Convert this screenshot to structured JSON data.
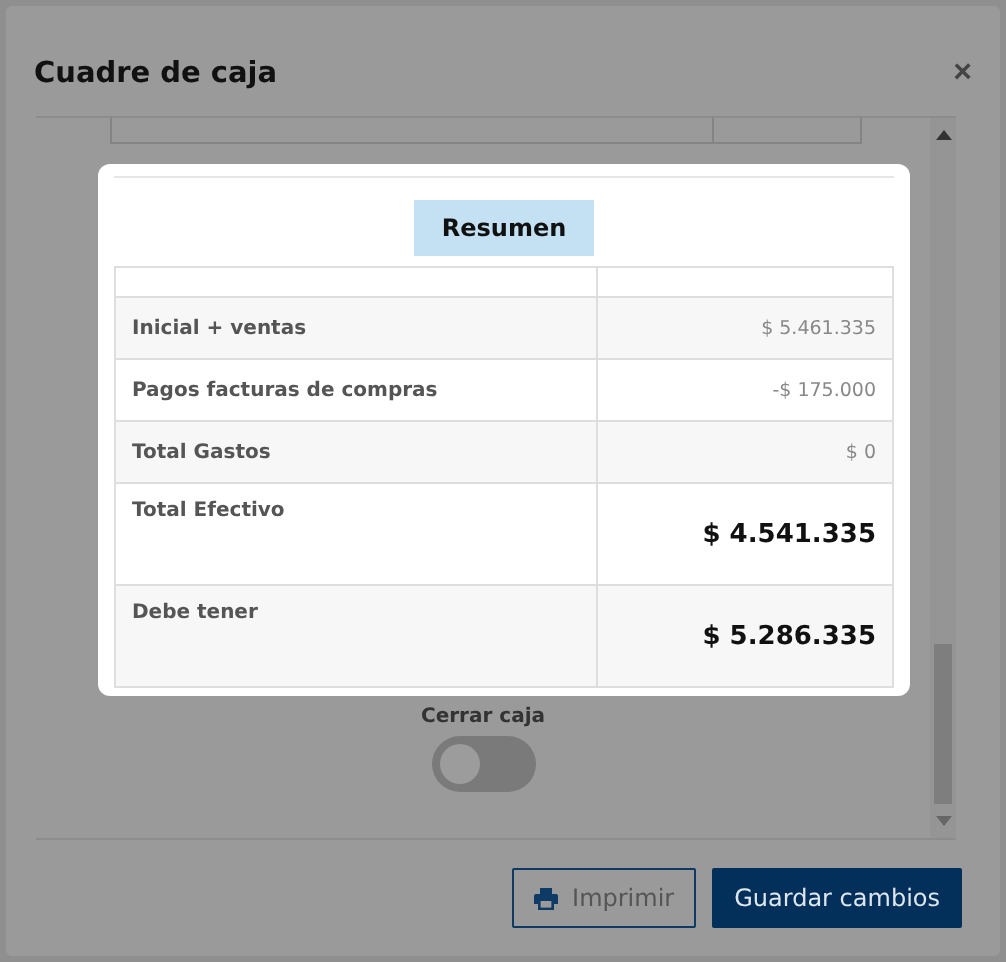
{
  "dialog": {
    "title": "Cuadre de caja",
    "close": "×"
  },
  "summary": {
    "title": "Resumen",
    "rows": [
      {
        "label": "Inicial + ventas",
        "value": "$ 5.461.335",
        "kind": "normal"
      },
      {
        "label": "Pagos facturas de compras",
        "value": "-$ 175.000",
        "kind": "normal"
      },
      {
        "label": "Total Gastos",
        "value": "$ 0",
        "kind": "normal"
      },
      {
        "label": "Total Efectivo",
        "value": "$ 4.541.335",
        "kind": "total"
      },
      {
        "label": "Debe tener",
        "value": "$ 5.286.335",
        "kind": "total"
      }
    ]
  },
  "close_register": {
    "label": "Cerrar caja",
    "on": false
  },
  "buttons": [
    {
      "label": "Imprimir",
      "kind": "outline"
    },
    {
      "label": "Guardar cambios",
      "kind": "primary"
    }
  ]
}
